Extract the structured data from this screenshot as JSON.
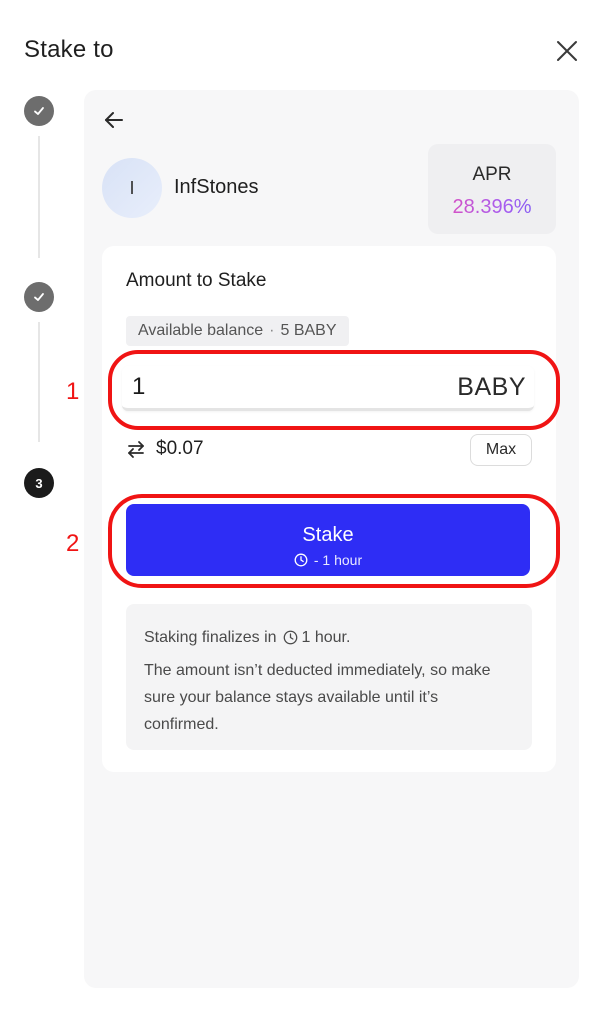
{
  "modal": {
    "title": "Stake to"
  },
  "stepper": {
    "steps": [
      {
        "state": "done"
      },
      {
        "state": "done"
      },
      {
        "state": "active",
        "number": "3"
      }
    ]
  },
  "validator": {
    "initial": "I",
    "name": "InfStones",
    "apr_label": "APR",
    "apr_value": "28.396%"
  },
  "form": {
    "title": "Amount to Stake",
    "balance_label": "Available balance",
    "balance_separator": "·",
    "balance_value": "5 BABY",
    "amount_value": "1",
    "amount_unit": "BABY",
    "usd_value": "$0.07",
    "max_label": "Max",
    "stake_label": "Stake",
    "stake_sub": "- 1 hour"
  },
  "info": {
    "line1_prefix": "Staking finalizes in",
    "line1_suffix": "1 hour.",
    "line2": "The amount isn’t deducted immediately, so make sure your balance stays available until it’s confirmed."
  },
  "annotations": {
    "one": "1",
    "two": "2",
    "color": "#f01414"
  },
  "colors": {
    "primary": "#2e2df5",
    "panel_bg": "#f7f7f8",
    "apr_gradient_start": "#e84cb4",
    "apr_gradient_end": "#6a5cf4"
  }
}
